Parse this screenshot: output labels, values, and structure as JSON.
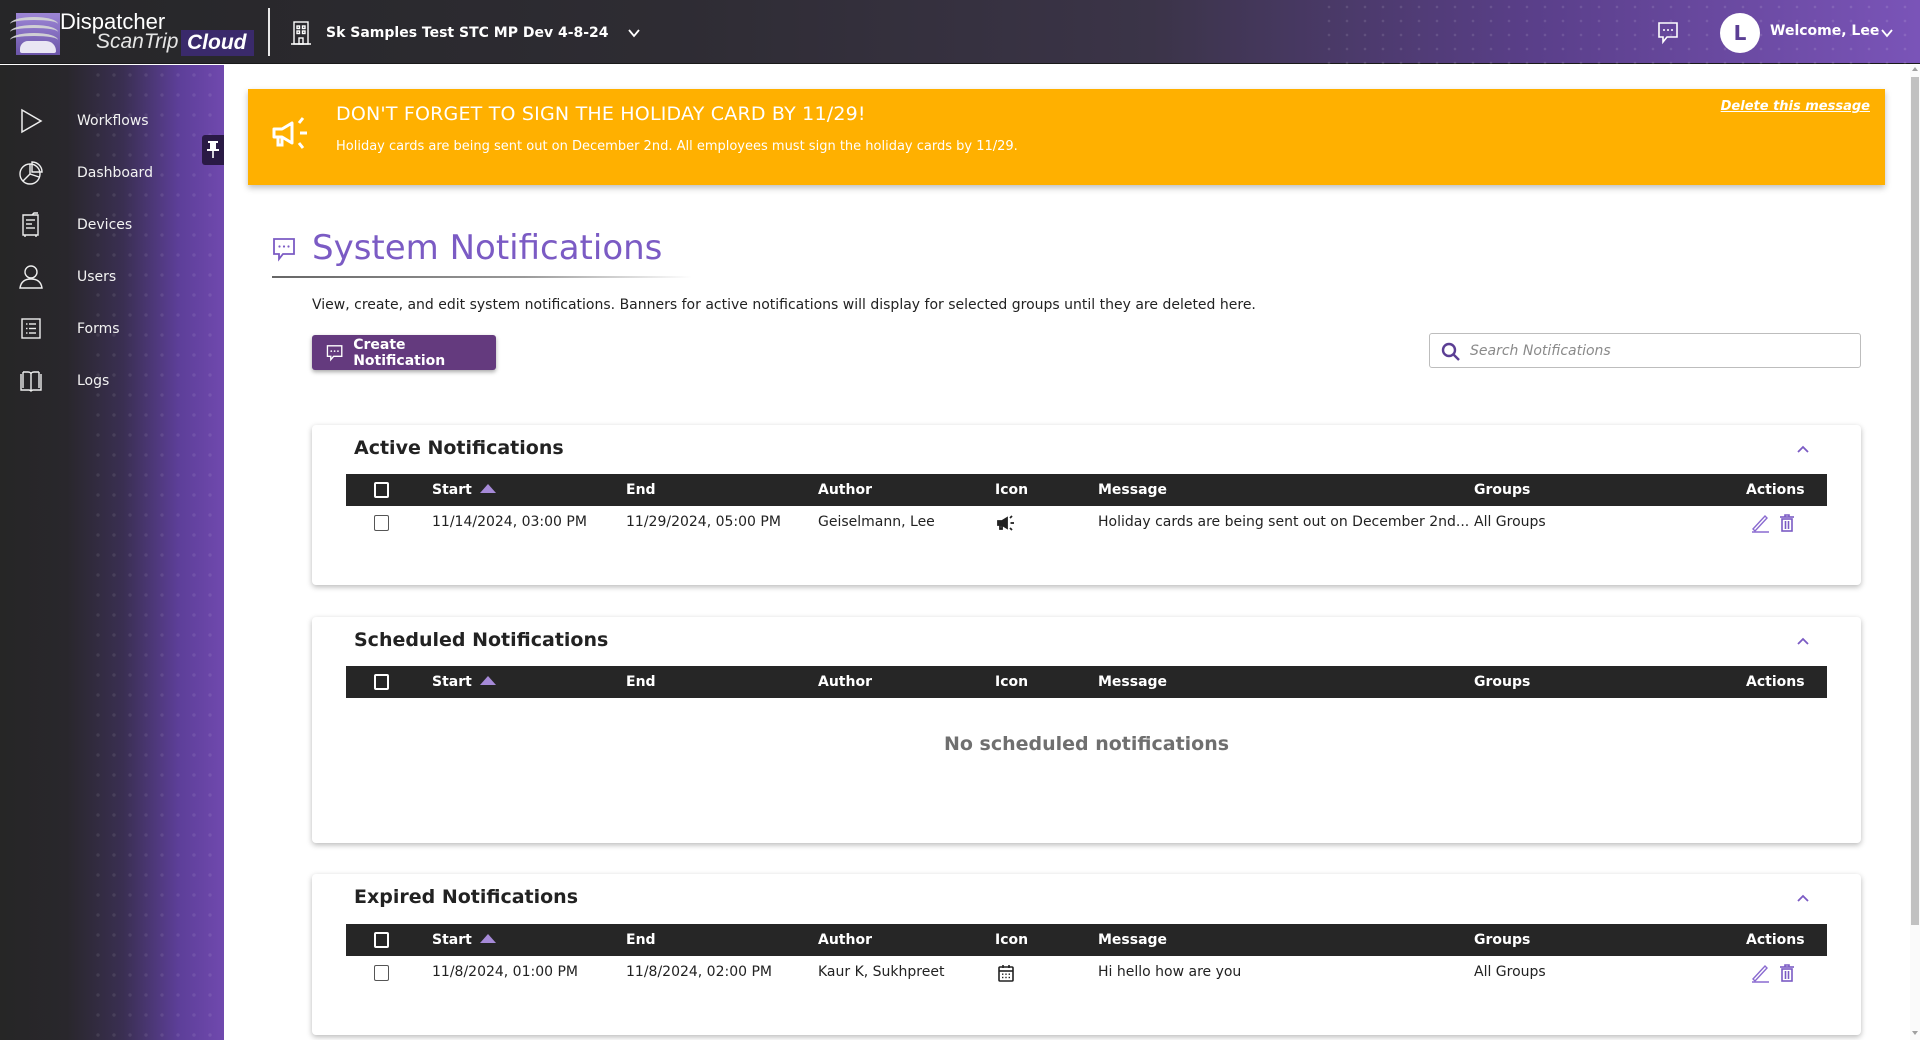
{
  "app": {
    "logo_title": "Dispatcher",
    "logo_sub": "ScanTrip",
    "logo_cloud": "Cloud"
  },
  "header": {
    "org_name": "Sk Samples Test STC MP Dev 4-8-24",
    "org_icon": "building-icon",
    "chat_icon": "message-icon",
    "avatar_initial": "L",
    "welcome": "Welcome, Lee"
  },
  "sidebar": {
    "pin_icon": "pin-icon",
    "items": [
      {
        "label": "Workflows",
        "icon": "play-icon"
      },
      {
        "label": "Dashboard",
        "icon": "pie-chart-icon"
      },
      {
        "label": "Devices",
        "icon": "printer-icon"
      },
      {
        "label": "Users",
        "icon": "user-icon"
      },
      {
        "label": "Forms",
        "icon": "list-icon"
      },
      {
        "label": "Logs",
        "icon": "book-icon"
      }
    ]
  },
  "banner": {
    "title": "DON'T FORGET TO SIGN THE HOLIDAY CARD BY 11/29!",
    "text": "Holiday cards are being sent out on December 2nd. All employees must sign the holiday cards by 11/29.",
    "delete_label": "Delete this message",
    "color": "#ffb000",
    "icon": "megaphone-icon"
  },
  "page": {
    "title": "System Notifications",
    "description": "View, create, and edit system notifications. Banners for active notifications will display for selected groups until they are deleted here.",
    "create_button": "Create Notification",
    "search_placeholder": "Search Notifications",
    "search_value": "",
    "accent_color": "#7b5bc4",
    "button_color": "#643a7e"
  },
  "columns": {
    "start": "Start",
    "end": "End",
    "author": "Author",
    "icon": "Icon",
    "message": "Message",
    "groups": "Groups",
    "actions": "Actions"
  },
  "sections": {
    "active": {
      "title": "Active Notifications",
      "rows": [
        {
          "start": "11/14/2024, 03:00 PM",
          "end": "11/29/2024, 05:00 PM",
          "author": "Geiselmann, Lee",
          "icon": "megaphone-icon",
          "message": "Holiday cards are being sent out on December 2nd...",
          "groups": "All Groups"
        }
      ]
    },
    "scheduled": {
      "title": "Scheduled Notifications",
      "empty_text": "No scheduled notifications",
      "rows": []
    },
    "expired": {
      "title": "Expired Notifications",
      "rows": [
        {
          "start": "11/8/2024, 01:00 PM",
          "end": "11/8/2024, 02:00 PM",
          "author": "Kaur K, Sukhpreet",
          "icon": "calendar-icon",
          "message": "Hi hello how are you",
          "groups": "All Groups"
        }
      ]
    }
  }
}
